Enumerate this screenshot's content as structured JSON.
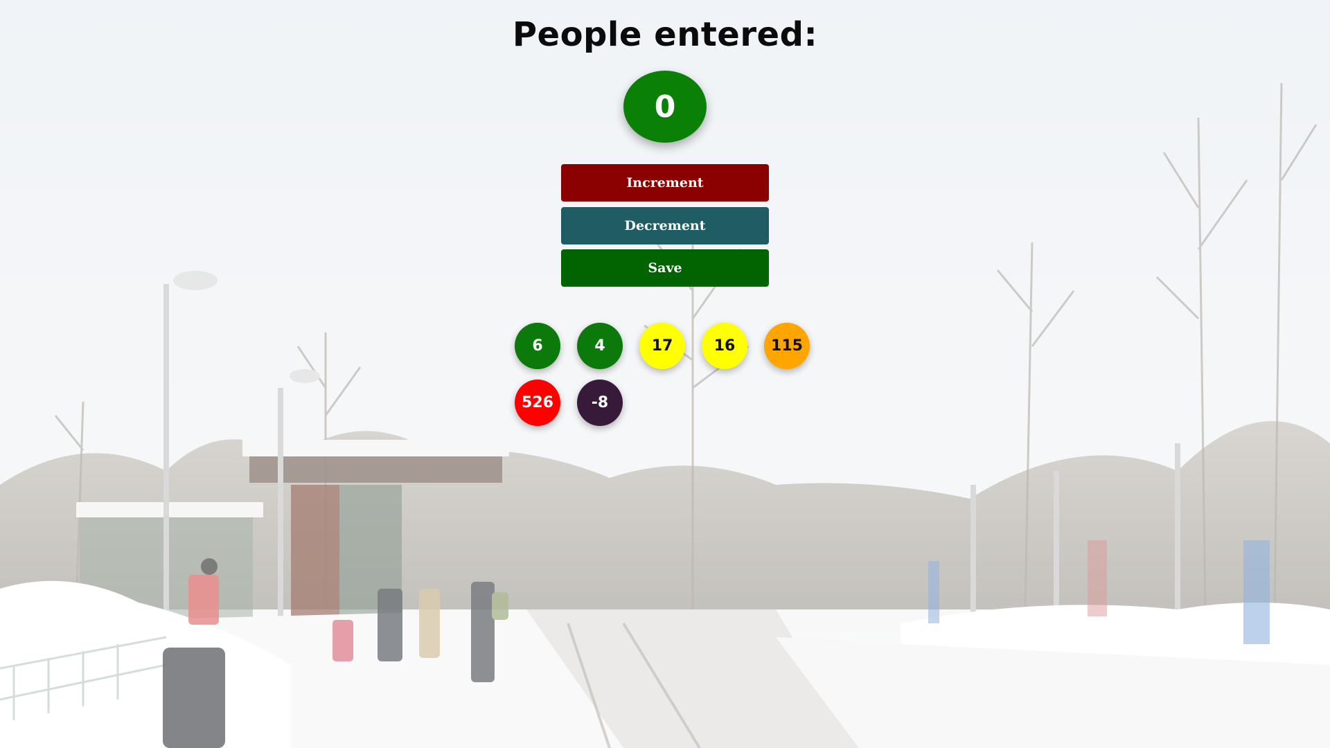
{
  "page": {
    "title": "People entered:"
  },
  "counter": {
    "value": "0",
    "color": "#0b8006"
  },
  "buttons": {
    "increment_label": "Increment",
    "decrement_label": "Decrement",
    "save_label": "Save"
  },
  "colors": {
    "increment": "#8b0000",
    "decrement": "#1f5c63",
    "save": "#016401"
  },
  "history": [
    {
      "value": "6",
      "bg": "#0b7a0b",
      "fg": "#ffffff"
    },
    {
      "value": "4",
      "bg": "#0b7a0b",
      "fg": "#ffffff"
    },
    {
      "value": "17",
      "bg": "#ffff00",
      "fg": "#111111"
    },
    {
      "value": "16",
      "bg": "#ffff00",
      "fg": "#111111"
    },
    {
      "value": "115",
      "bg": "#ffa500",
      "fg": "#111111"
    },
    {
      "value": "526",
      "bg": "#ff0000",
      "fg": "#ffffff"
    },
    {
      "value": "-8",
      "bg": "#371a3a",
      "fg": "#ffffff"
    }
  ]
}
